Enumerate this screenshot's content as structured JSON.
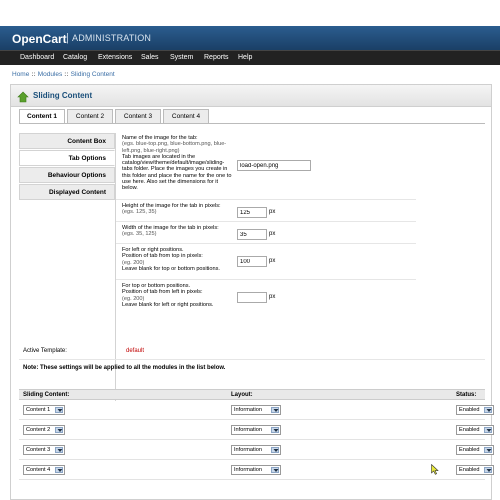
{
  "header": {
    "logo": "OpenCart",
    "separator": "|",
    "subtitle": "ADMINISTRATION"
  },
  "menu": [
    "Dashboard",
    "Catalog",
    "Extensions",
    "Sales",
    "System",
    "Reports",
    "Help"
  ],
  "breadcrumb": [
    "Home",
    "Modules",
    "Sliding Content"
  ],
  "panel": {
    "title": "Sliding Content"
  },
  "tabs": [
    "Content 1",
    "Content 2",
    "Content 3",
    "Content 4"
  ],
  "vertical_tabs": [
    "Content Box",
    "Tab Options",
    "Behaviour Options",
    "Displayed Content"
  ],
  "fields": {
    "image_name": {
      "label": "Name of the image for the tab:",
      "help": "(egs. blue-top.png, blue-bottom.png, blue-left.png, blue-right.png)",
      "desc": "Tab images are located in the catalog/view/theme/default/image/sliding-tabs folder. Place the images you create in this folder and place the name for the one to use here. Also set the dimensions for it below.",
      "value": "load-open.png"
    },
    "height": {
      "label": "Height of the image for the tab in pixels:",
      "help": "(egs. 125, 35)",
      "value": "125",
      "unit": "px"
    },
    "width": {
      "label": "Width of the image for the tab in pixels:",
      "help": "(egs. 35, 125)",
      "value": "35",
      "unit": "px"
    },
    "top_pos": {
      "label": "For left or right positions.",
      "label2": "Position of tab from top in pixels:",
      "help": "(eg. 200)",
      "desc": "Leave blank for top or bottom positions.",
      "value": "100",
      "unit": "px"
    },
    "left_pos": {
      "label": "For top or bottom positions.",
      "label2": "Position of tab from left in pixels:",
      "help": "(eg. 200)",
      "desc": "Leave blank for left or right positions.",
      "value": "",
      "unit": "px"
    }
  },
  "active_template": {
    "label": "Active Template:",
    "value": "default"
  },
  "note": "Note: These settings will be applied to all the modules in the list below.",
  "modules_table": {
    "headers": [
      "Sliding Content:",
      "Layout:",
      "Status:"
    ],
    "rows": [
      {
        "content": "Content 1",
        "layout": "Information",
        "status": "Enabled"
      },
      {
        "content": "Content 2",
        "layout": "Information",
        "status": "Enabled"
      },
      {
        "content": "Content 3",
        "layout": "Information",
        "status": "Enabled"
      },
      {
        "content": "Content 4",
        "layout": "Information",
        "status": "Enabled"
      }
    ]
  },
  "colors": {
    "header": "#2b5d8f",
    "menubar": "#222222",
    "accent_red": "#c00000",
    "link": "#3a6ea5"
  }
}
